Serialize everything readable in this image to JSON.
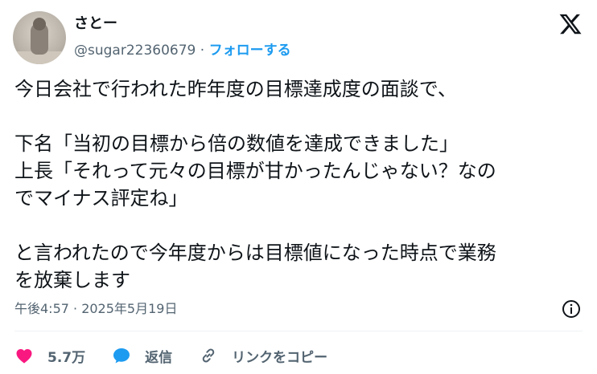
{
  "user": {
    "name": "さとー",
    "handle": "@sugar22360679",
    "separator": "·",
    "follow_label": "フォローする"
  },
  "tweet": {
    "text": "今日会社で行われた昨年度の目標達成度の面談で、\n\n下名「当初の目標から倍の数値を達成できました」\n上長「それって元々の目標が甘かったんじゃない？なの\nでマイナス評定ね」\n\nと言われたので今年度からは目標値になった時点で業務\nを放棄します",
    "timestamp": "午後4:57 · 2025年5月19日"
  },
  "actions": {
    "likes": "5.7万",
    "reply_label": "返信",
    "copy_link_label": "リンクをコピー"
  },
  "colors": {
    "accent": "#1d9bf0",
    "like": "#f91880",
    "text": "#0f1419",
    "secondary": "#536471"
  },
  "icons": [
    "x-logo-icon",
    "info-icon",
    "heart-icon",
    "reply-bubble-icon",
    "link-icon"
  ]
}
